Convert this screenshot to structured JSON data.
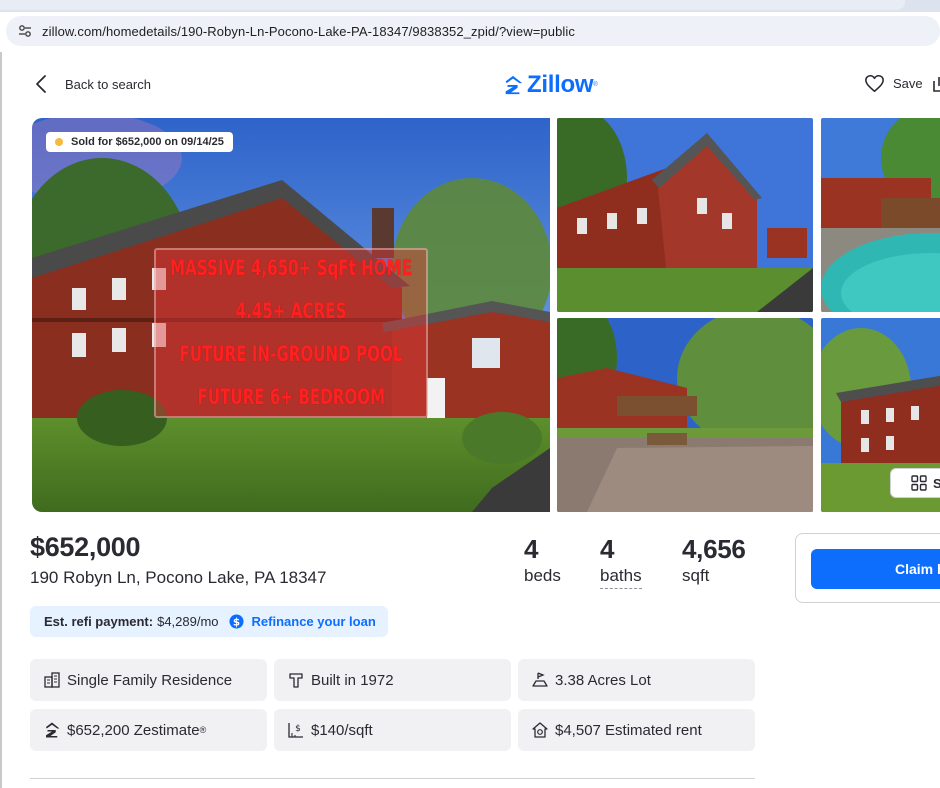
{
  "browser": {
    "url": "zillow.com/homedetails/190-Robyn-Ln-Pocono-Lake-PA-18347/9838352_zpid/?view=public"
  },
  "nav": {
    "back_label": "Back to search",
    "logo_text": "Zillow",
    "save_label": "Save"
  },
  "gallery": {
    "sold_badge": "Sold for $652,000 on 09/14/25",
    "promo_lines": [
      "MASSIVE 4,650+ SqFt HOME",
      "4.45+ ACRES",
      "FUTURE IN-GROUND POOL",
      "FUTURE 6+ BEDROOM"
    ],
    "see_all_label": "S"
  },
  "summary": {
    "price": "$652,000",
    "address": "190 Robyn Ln, Pocono Lake, PA 18347",
    "beds": {
      "num": "4",
      "unit": "beds"
    },
    "baths": {
      "num": "4",
      "unit": "baths"
    },
    "sqft": {
      "num": "4,656",
      "unit": "sqft"
    },
    "claim_label": "Claim h"
  },
  "refi": {
    "label": "Est. refi payment:",
    "value": "$4,289/mo",
    "link": "Refinance your loan"
  },
  "facts": {
    "type": "Single Family Residence",
    "built": "Built in 1972",
    "lot": "3.38 Acres Lot",
    "zestimate": "$652,200 Zestimate",
    "zestimate_mark": "®",
    "price_sqft": "$140/sqft",
    "rent": "$4,507 Estimated rent"
  },
  "colors": {
    "brand_blue": "#0d6efd",
    "sold_dot": "#f7b93e",
    "refi_bg": "#e6f2ff",
    "fact_bg": "#f1f1f4"
  },
  "icons": [
    "tune-icon",
    "chevron-left-icon",
    "zillow-logo-icon",
    "heart-icon",
    "share-icon",
    "grid-icon",
    "dollar-circle-icon",
    "building-icon",
    "hammer-icon",
    "lot-icon",
    "zestimate-icon",
    "price-sqft-icon",
    "rent-icon"
  ]
}
